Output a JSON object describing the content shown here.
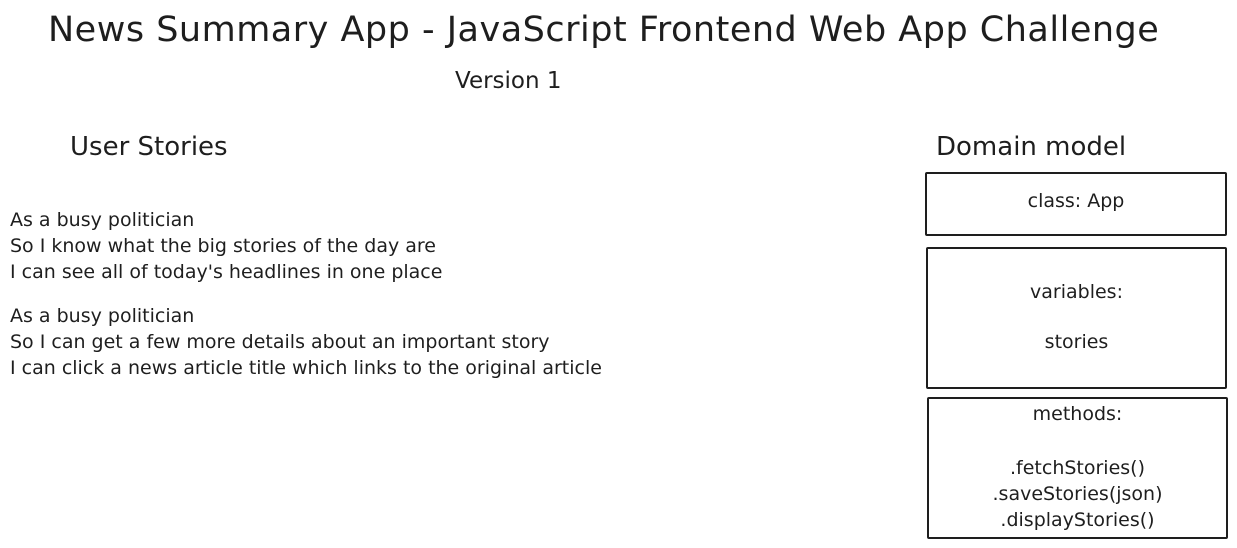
{
  "header": {
    "title": "News Summary App - JavaScript Frontend Web App Challenge",
    "version": "Version 1"
  },
  "user_stories": {
    "heading": "User Stories",
    "stories": [
      {
        "lines": [
          "As a busy politician",
          "So I know what the big stories of the day are",
          "I can see all of today's headlines in one place"
        ]
      },
      {
        "lines": [
          "As a busy politician",
          "So I can get a few more details about an important story",
          "I can click a news article title which links to the original article"
        ]
      }
    ]
  },
  "domain_model": {
    "heading": "Domain model",
    "class_label": "class: App",
    "variables_label": "variables:",
    "variables": [
      "stories"
    ],
    "methods_label": "methods:",
    "methods": [
      ".fetchStories()",
      ".saveStories(json)",
      ".displayStories()"
    ]
  }
}
